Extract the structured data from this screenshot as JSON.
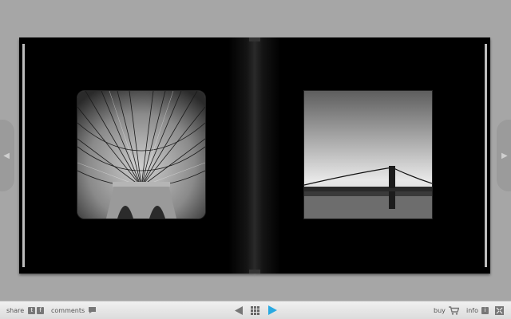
{
  "toolbar": {
    "share_label": "share",
    "share_icons": [
      "t",
      "f"
    ],
    "comments_label": "comments",
    "buy_label": "buy",
    "info_label": "info",
    "info_icon": "i",
    "icons": {
      "share_twitter": "twitter-icon",
      "share_facebook": "facebook-icon",
      "comments": "speech-bubble-icon",
      "prev": "triangle-left-icon",
      "grid": "grid-icon",
      "next": "triangle-right-icon",
      "cart": "cart-icon",
      "fullscreen": "fullscreen-icon"
    }
  },
  "colors": {
    "background": "#a6a6a6",
    "page": "#000000",
    "accent_next": "#29a9e1",
    "toolbar": "#e6e6e6"
  },
  "book": {
    "left_photo": "bridge-cables-photo",
    "right_photo": "bridge-skyline-photo"
  }
}
